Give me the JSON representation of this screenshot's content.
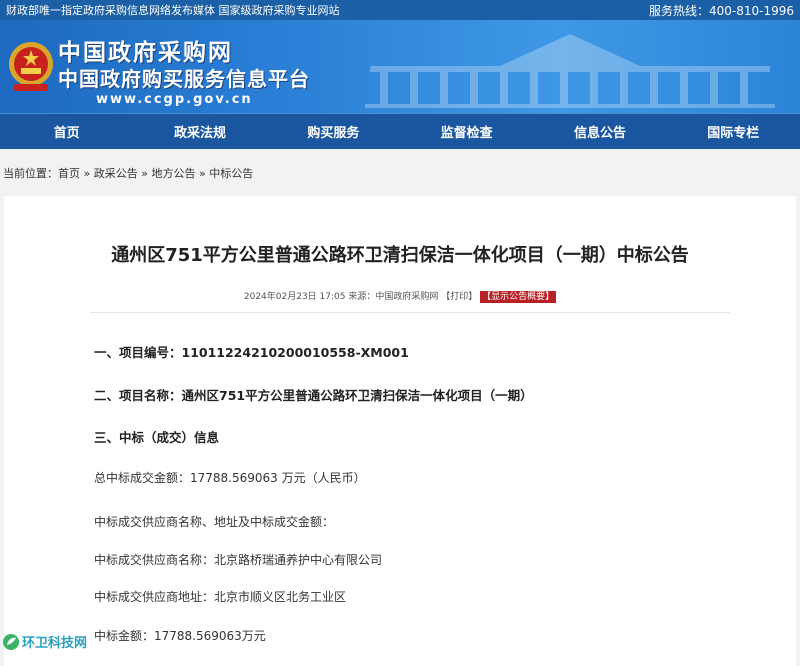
{
  "topbar": {
    "notice": "财政部唯一指定政府采购信息网络发布媒体 国家级政府采购专业网站",
    "hotline": "服务热线：400-810-1996"
  },
  "header": {
    "site_name": "中国政府采购网",
    "site_subtitle": "中国政府购买服务信息平台",
    "url": "www.ccgp.gov.cn"
  },
  "nav": {
    "items": [
      "首页",
      "政采法规",
      "购买服务",
      "监督检查",
      "信息公告",
      "国际专栏"
    ]
  },
  "breadcrumb": {
    "prefix": "当前位置：",
    "items": [
      "首页",
      "政采公告",
      "地方公告",
      "中标公告"
    ],
    "sep": " » "
  },
  "article": {
    "title": "通州区751平方公里普通公路环卫清扫保洁一体化项目（一期）中标公告",
    "date": "2024年02月23日 17:05",
    "source": " 来源：中国政府采购网 ",
    "print_label": "【打印】",
    "summary_label": "【显示公告概要】",
    "sections": [
      "一、项目编号：1101122421020001055​8-XM001",
      "二、项目名称：通州区751平方公里普通公路环卫清扫保洁一体化项目（一期）",
      "三、中标（成交）信息"
    ],
    "paragraphs": [
      "总中标成交金额：17788.569063 万元（人民币）",
      "中标成交供应商名称、地址及中标成交金额：",
      "中标成交供应商名称：北京路桥瑞通养护中心有限公司",
      "中标成交供应商地址：北京市顺义区北务工业区",
      "中标金额：17788.569063万元"
    ]
  },
  "watermark": {
    "text": "环卫科技网"
  },
  "colors": {
    "nav_bg": "#1a57a0",
    "banner_bg": "#2a7fd6",
    "badge_red": "#b82025"
  }
}
